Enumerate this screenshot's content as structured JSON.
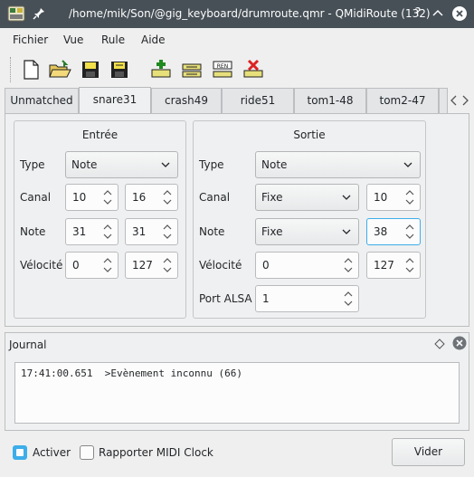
{
  "window": {
    "title": "/home/mik/Son/@gig_keyboard/drumroute.qmr - QMidiRoute (132)",
    "app_icon": "qmidiroute-icon",
    "pin_icon": "pin-icon",
    "buttons": [
      "help-icon",
      "minimize-icon",
      "maximize-icon",
      "close-icon"
    ]
  },
  "menu": {
    "items": [
      "Fichier",
      "Vue",
      "Rule",
      "Aide"
    ]
  },
  "toolbar": {
    "buttons": [
      "new-file-icon",
      "open-folder-icon",
      "save-icon",
      "save-as-icon",
      "add-rule-icon",
      "rename-rule-icon",
      "ren-icon",
      "delete-rule-icon"
    ]
  },
  "tabs": {
    "items": [
      "Unmatched",
      "snare31",
      "crash49",
      "ride51",
      "tom1-48",
      "tom2-47"
    ],
    "active": "snare31"
  },
  "input_group": {
    "title": "Entrée",
    "type_label": "Type",
    "type_value": "Note",
    "canal_label": "Canal",
    "canal_min": "10",
    "canal_max": "16",
    "note_label": "Note",
    "note_min": "31",
    "note_max": "31",
    "velocity_label": "Vélocité",
    "velocity_min": "0",
    "velocity_max": "127"
  },
  "output_group": {
    "title": "Sortie",
    "type_label": "Type",
    "type_value": "Note",
    "canal_label": "Canal",
    "canal_mode": "Fixe",
    "canal_value": "10",
    "note_label": "Note",
    "note_mode": "Fixe",
    "note_value": "38",
    "velocity_label": "Vélocité",
    "velocity_offset": "0",
    "velocity_value": "127",
    "port_label": "Port ALSA",
    "port_value": "1"
  },
  "journal": {
    "title": "Journal",
    "log_line": "17:41:00.651  >Evènement inconnu (66)"
  },
  "footer": {
    "enable_label": "Activer",
    "enable_checked": true,
    "midi_clock_label": "Rapporter MIDI Clock",
    "midi_clock_checked": false,
    "clear_label": "Vider"
  },
  "colors": {
    "titlebar": "#475057",
    "accent": "#3daee9",
    "window": "#efefef"
  }
}
